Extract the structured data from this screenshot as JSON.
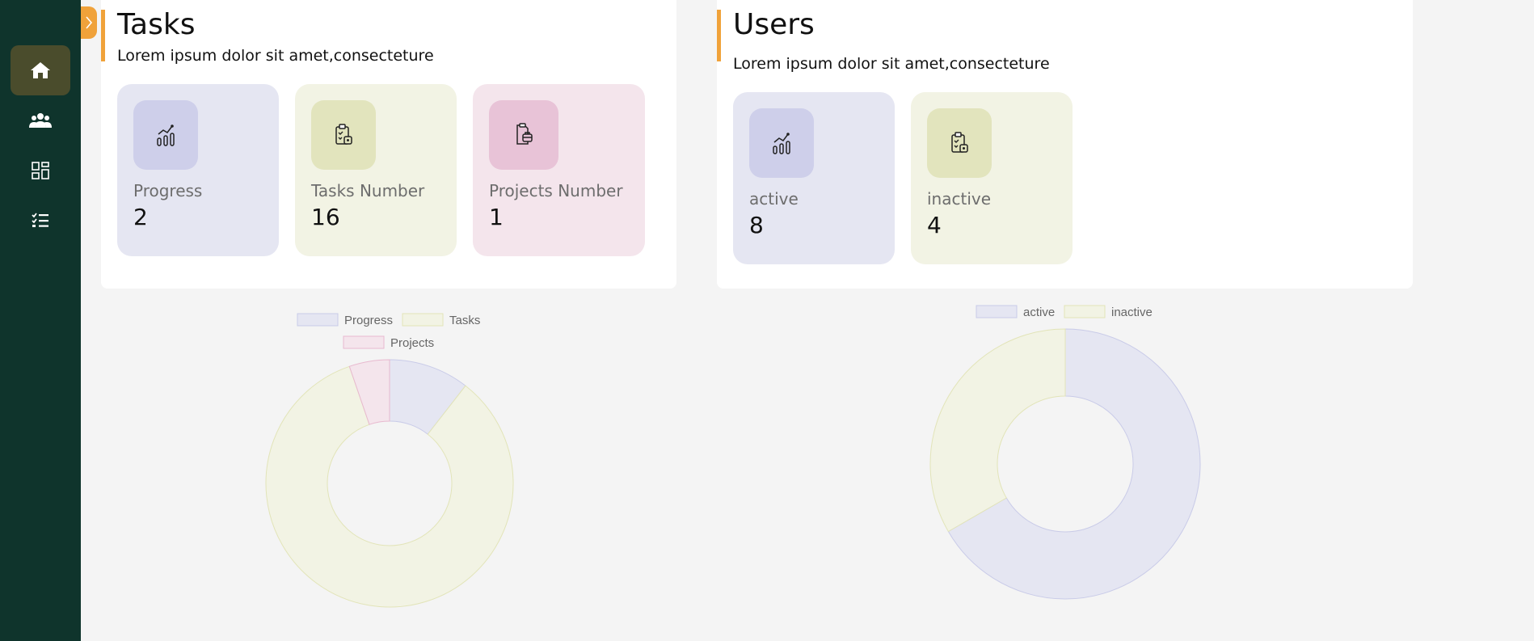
{
  "sidebar": {
    "items": [
      {
        "name": "home",
        "icon": "home-icon",
        "active": true
      },
      {
        "name": "users",
        "icon": "users-icon",
        "active": false
      },
      {
        "name": "projects",
        "icon": "grid-icon",
        "active": false
      },
      {
        "name": "tasks",
        "icon": "checklist-icon",
        "active": false
      }
    ]
  },
  "tasks_panel": {
    "title": "Tasks",
    "subtitle": "Lorem ipsum dolor sit amet,consecteture",
    "cards": [
      {
        "label": "Progress",
        "value": "2",
        "icon": "chart-icon"
      },
      {
        "label": "Tasks Number",
        "value": "16",
        "icon": "clipboard-icon"
      },
      {
        "label": "Projects Number",
        "value": "1",
        "icon": "project-clipboard-icon"
      }
    ]
  },
  "users_panel": {
    "title": "Users",
    "subtitle": "Lorem ipsum dolor sit amet,consecteture",
    "cards": [
      {
        "label": "active",
        "value": "8",
        "icon": "chart-icon"
      },
      {
        "label": "inactive",
        "value": "4",
        "icon": "clipboard-icon"
      }
    ]
  },
  "colors": {
    "sidebar": "#0f342c",
    "accent": "#f0a23a",
    "purple": "#e5e6f2",
    "olive": "#f2f3e4",
    "pink": "#f4e5ec"
  },
  "chart_data": [
    {
      "type": "doughnut",
      "categories": [
        "Progress",
        "Tasks",
        "Projects"
      ],
      "values": [
        2,
        16,
        1
      ],
      "colors": [
        "#e5e6f2",
        "#f2f3e4",
        "#f4e5ec"
      ],
      "border_colors": [
        "#c9cbe8",
        "#e2e4b8",
        "#e8b9cf"
      ],
      "legend": "top"
    },
    {
      "type": "doughnut",
      "categories": [
        "active",
        "inactive"
      ],
      "values": [
        8,
        4
      ],
      "colors": [
        "#e5e6f2",
        "#f2f3e4"
      ],
      "border_colors": [
        "#c9cbe8",
        "#e2e4b8"
      ],
      "legend": "top"
    }
  ]
}
